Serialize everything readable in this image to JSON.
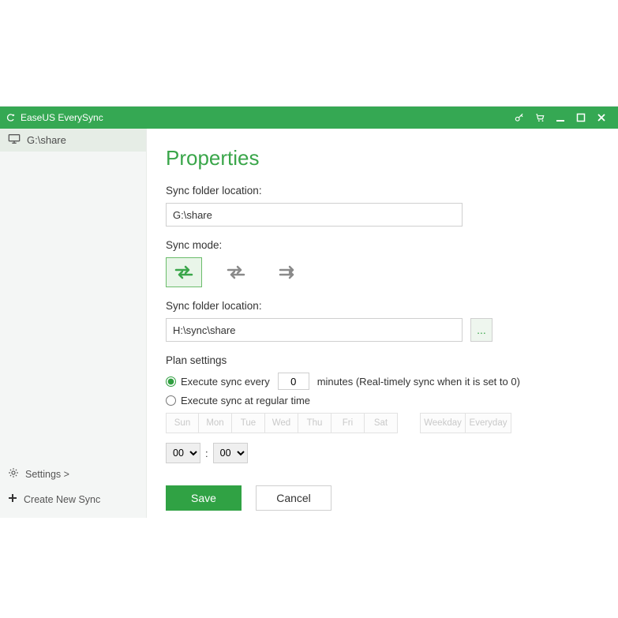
{
  "titlebar": {
    "app_name": "EaseUS EverySync"
  },
  "sidebar": {
    "active_item_label": "G:\\share",
    "settings_label": "Settings >",
    "create_label": "Create New Sync"
  },
  "content": {
    "page_title": "Properties",
    "loc1_label": "Sync folder location:",
    "loc1_value": "G:\\share",
    "mode_label": "Sync mode:",
    "loc2_label": "Sync folder location:",
    "loc2_value": "H:\\sync\\share",
    "dots": "...",
    "plan_title": "Plan settings",
    "radio_every_prefix": "Execute sync every",
    "radio_every_value": "0",
    "radio_every_suffix": "minutes (Real-timely sync when it is set to 0)",
    "radio_regular": "Execute sync at regular time",
    "days": [
      "Sun",
      "Mon",
      "Tue",
      "Wed",
      "Thu",
      "Fri",
      "Sat"
    ],
    "day_groups": [
      "Weekday",
      "Everyday"
    ],
    "hour": "00",
    "minute": "00",
    "colon": ":",
    "save": "Save",
    "cancel": "Cancel"
  }
}
